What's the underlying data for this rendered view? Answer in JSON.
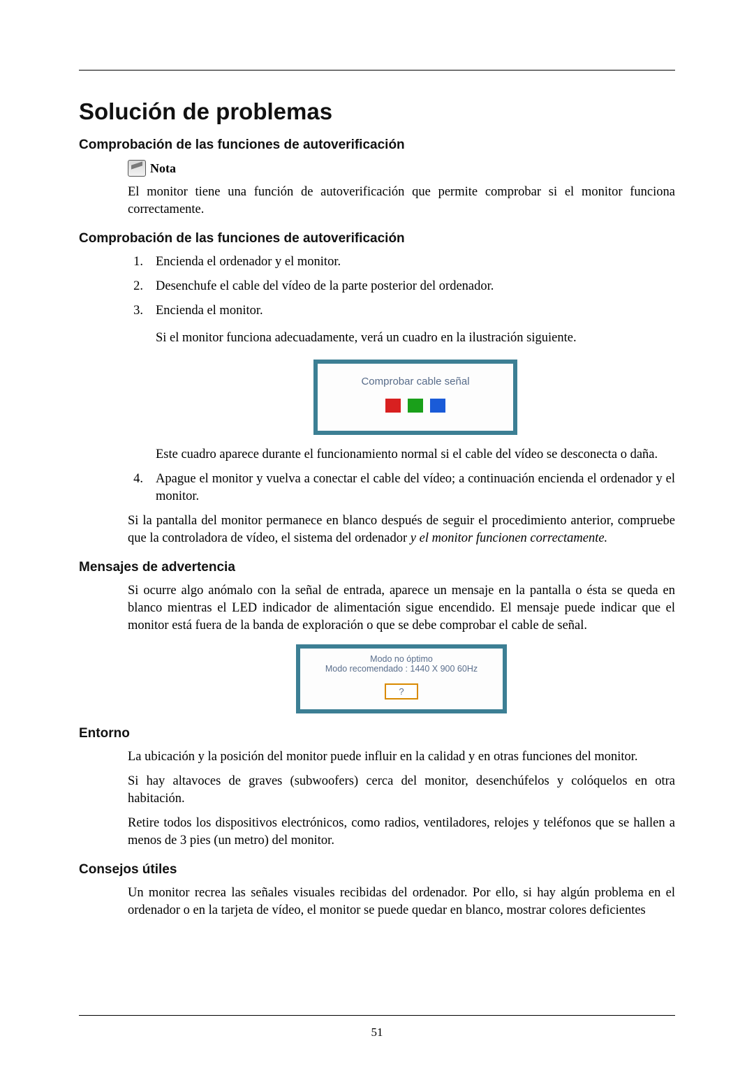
{
  "page_number": "51",
  "title": "Solución de problemas",
  "s1": {
    "heading": "Comprobación de las funciones de autoverificación",
    "note_label": "Nota",
    "note_text": "El monitor tiene una función de autoverificación que permite comprobar si el monitor funciona correctamente."
  },
  "s2": {
    "heading": "Comprobación de las funciones de autoverificación",
    "steps": {
      "n1": "1.",
      "t1": "Encienda el ordenador y el monitor.",
      "n2": "2.",
      "t2": "Desenchufe el cable del vídeo de la parte posterior del ordenador.",
      "n3": "3.",
      "t3": "Encienda el monitor.",
      "t3b": "Si el monitor funciona adecuadamente, verá un cuadro en la ilustración siguiente.",
      "dialog_text": "Comprobar cable señal",
      "t3c": "Este cuadro aparece durante el funcionamiento normal si el cable del vídeo se desconecta o daña.",
      "n4": "4.",
      "t4": "Apague el monitor y vuelva a conectar el cable del vídeo; a continuación encienda el ordenador y el monitor."
    },
    "post_a": "Si la pantalla del monitor permanece en blanco después de seguir el procedimiento anterior, compruebe que la controladora de vídeo, el sistema del ordenador ",
    "post_b_italic": "y el monitor funcionen correctamente."
  },
  "s3": {
    "heading": "Mensajes de advertencia",
    "text": "Si ocurre algo anómalo con la señal de entrada, aparece un mensaje en la pantalla o ésta se queda en blanco mientras el LED indicador de alimentación sigue encendido. El mensaje puede indicar que el monitor está fuera de la banda de exploración o que se debe comprobar el cable de señal.",
    "dialog_line1": "Modo no óptimo",
    "dialog_line2": "Modo recomendado :  1440 X 900  60Hz",
    "dialog_btn": "?"
  },
  "s4": {
    "heading": "Entorno",
    "p1": "La ubicación y la posición del monitor puede influir en la calidad y en otras funciones del monitor.",
    "p2": "Si hay altavoces de graves (subwoofers) cerca del monitor, desenchúfelos y colóquelos en otra habitación.",
    "p3": "Retire todos los dispositivos electrónicos, como radios, ventiladores, relojes y teléfonos que se hallen a menos de 3 pies (un metro) del monitor."
  },
  "s5": {
    "heading": "Consejos útiles",
    "p1": "Un monitor recrea las señales visuales recibidas del ordenador. Por ello, si hay algún problema en el ordenador o en la tarjeta de vídeo, el monitor se puede quedar en blanco, mostrar colores deficientes"
  }
}
